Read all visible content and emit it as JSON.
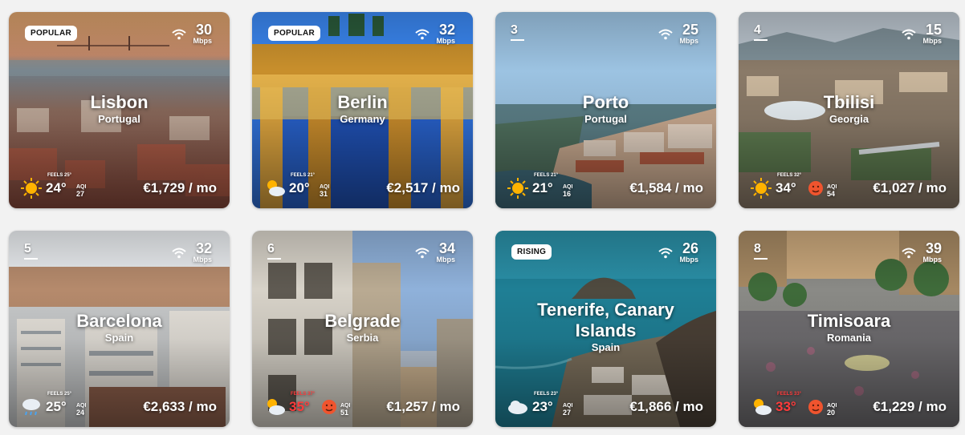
{
  "cards": [
    {
      "city": "Lisbon",
      "country": "Portugal",
      "tag": "POPULAR",
      "speed": "30",
      "unit": "Mbps",
      "temp": "24°",
      "feels": "FEELS 25°",
      "aqi_label": "AQI",
      "aqi": "27",
      "price": "€1,729 / mo",
      "weather": "sun-icon"
    },
    {
      "city": "Berlin",
      "country": "Germany",
      "tag": "POPULAR",
      "speed": "32",
      "unit": "Mbps",
      "temp": "20°",
      "feels": "FEELS 21°",
      "aqi_label": "AQI",
      "aqi": "31",
      "price": "€2,517 / mo",
      "weather": "partly-cloudy-icon"
    },
    {
      "city": "Porto",
      "country": "Portugal",
      "rank": "3",
      "speed": "25",
      "unit": "Mbps",
      "temp": "21°",
      "feels": "FEELS 21°",
      "aqi_label": "AQI",
      "aqi": "16",
      "price": "€1,584 / mo",
      "weather": "sun-icon"
    },
    {
      "city": "Tbilisi",
      "country": "Georgia",
      "rank": "4",
      "speed": "15",
      "unit": "Mbps",
      "temp": "34°",
      "feels": "FEELS 32°",
      "aqi_label": "AQI",
      "aqi": "54",
      "price": "€1,027 / mo",
      "weather": "sun-icon"
    },
    {
      "city": "Barcelona",
      "country": "Spain",
      "rank": "5",
      "speed": "32",
      "unit": "Mbps",
      "temp": "25°",
      "feels": "FEELS 25°",
      "aqi_label": "AQI",
      "aqi": "24",
      "price": "€2,633 / mo",
      "weather": "rain-cloud-icon"
    },
    {
      "city": "Belgrade",
      "country": "Serbia",
      "rank": "6",
      "speed": "34",
      "unit": "Mbps",
      "temp": "35°",
      "feels": "FEELS 37°",
      "aqi_label": "AQI",
      "aqi": "51",
      "price": "€1,257 / mo",
      "weather": "partly-cloudy-icon"
    },
    {
      "city": "Tenerife, Canary Islands",
      "country": "Spain",
      "tag": "RISING",
      "speed": "26",
      "unit": "Mbps",
      "temp": "23°",
      "feels": "FEELS 23°",
      "aqi_label": "AQI",
      "aqi": "27",
      "price": "€1,866 / mo",
      "weather": "cloud-icon"
    },
    {
      "city": "Timisoara",
      "country": "Romania",
      "rank": "8",
      "speed": "39",
      "unit": "Mbps",
      "temp": "33°",
      "feels": "FEELS 33°",
      "aqi_label": "AQI",
      "aqi": "20",
      "price": "€1,229 / mo",
      "weather": "partly-cloudy-icon"
    }
  ]
}
